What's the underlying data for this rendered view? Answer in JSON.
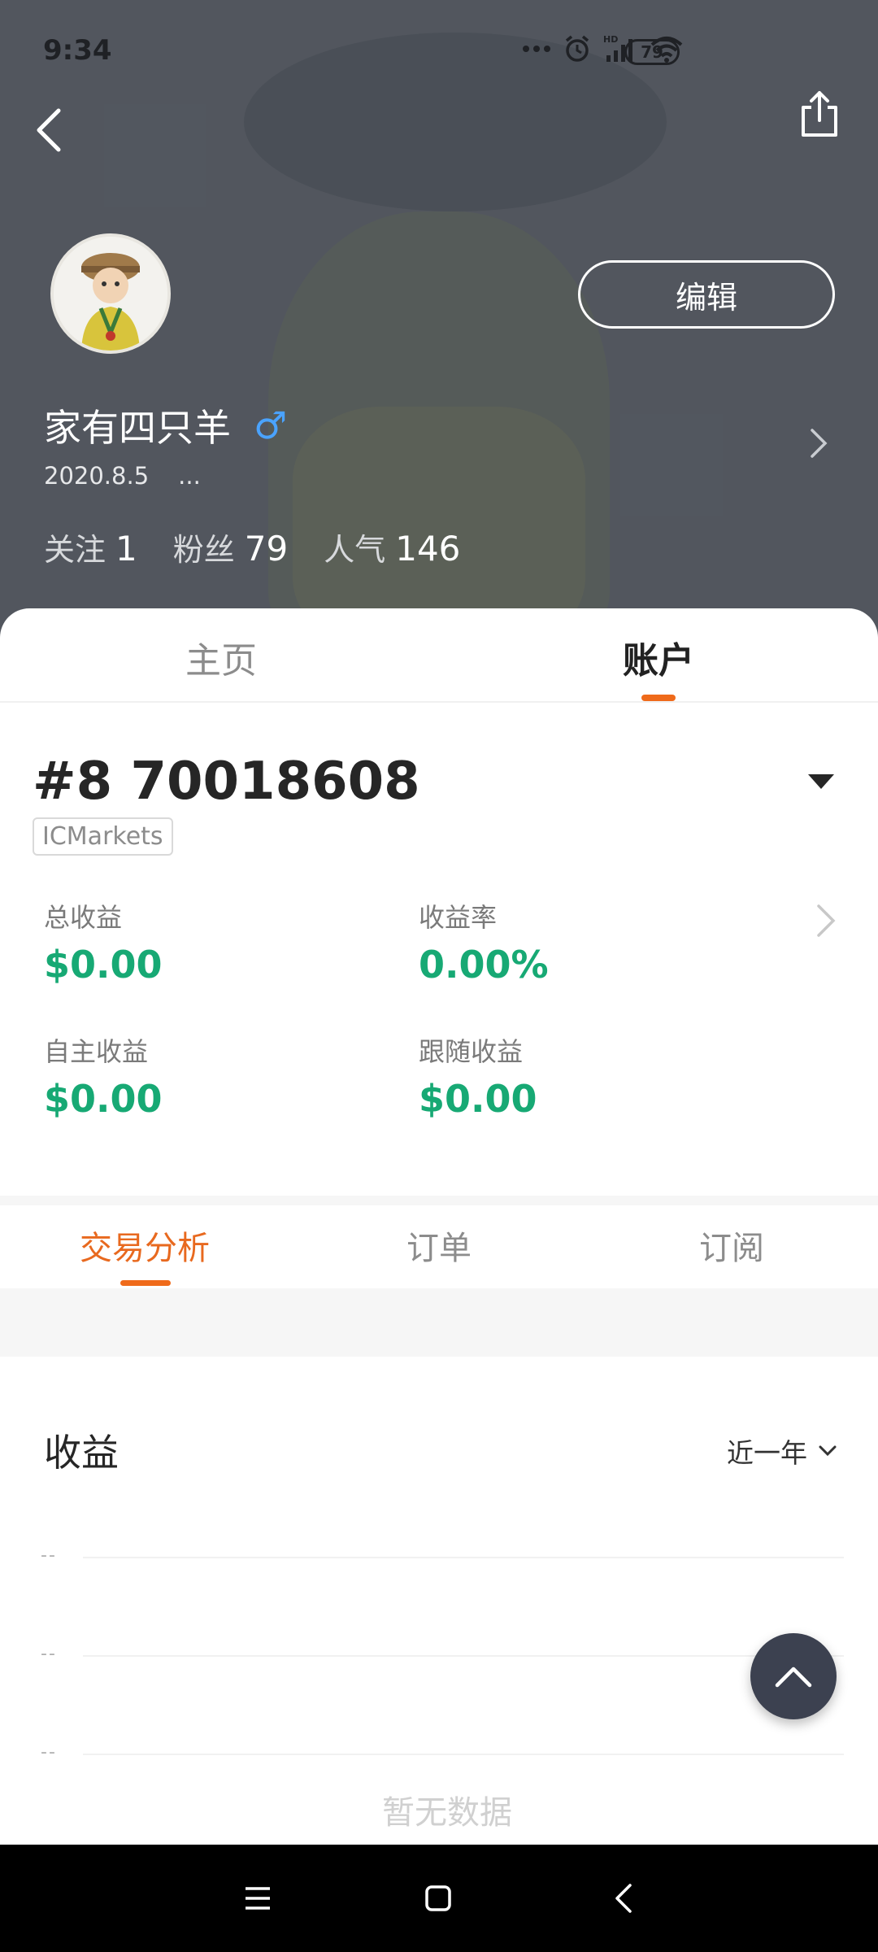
{
  "status_bar": {
    "time": "9:34",
    "battery": "79",
    "icons": [
      "more-dots-icon",
      "alarm-icon",
      "hd-signal-icon",
      "wifi-icon",
      "battery-icon"
    ]
  },
  "profile": {
    "name": "家有四只羊",
    "gender_symbol": "♂",
    "date": "2020.8.5",
    "ellipsis": "...",
    "edit_label": "编辑",
    "stats": {
      "following_label": "关注",
      "following_value": "1",
      "fans_label": "粉丝",
      "fans_value": "79",
      "popularity_label": "人气",
      "popularity_value": "146"
    }
  },
  "main_tabs": {
    "home": "主页",
    "account": "账户",
    "active": "account"
  },
  "account": {
    "number": "#8 70018608",
    "broker": "ICMarkets",
    "metrics": {
      "total_label": "总收益",
      "total_value": "$0.00",
      "rate_label": "收益率",
      "rate_value": "0.00%",
      "self_label": "自主收益",
      "self_value": "$0.00",
      "follow_label": "跟随收益",
      "follow_value": "$0.00"
    }
  },
  "sub_tabs": {
    "analysis": "交易分析",
    "orders": "订单",
    "subscribe": "订阅",
    "active": "analysis"
  },
  "earnings": {
    "title": "收益",
    "period": "近一年",
    "axis_placeholder": "--",
    "no_data": "暂无数据"
  },
  "colors": {
    "accent": "#ef6a1a",
    "positive": "#17a974",
    "gender_blue": "#4aa3ff",
    "fab": "#3c4150"
  }
}
